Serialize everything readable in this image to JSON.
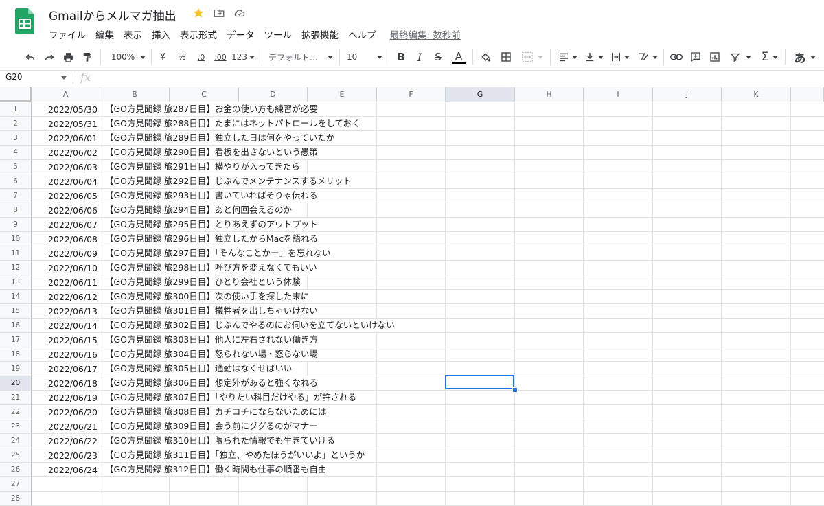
{
  "app": {
    "title": "Gmailからメルマガ抽出",
    "menu": [
      "ファイル",
      "編集",
      "表示",
      "挿入",
      "表示形式",
      "データ",
      "ツール",
      "拡張機能",
      "ヘルプ"
    ],
    "last_edit": "最終編集: 数秒前"
  },
  "toolbar": {
    "zoom": "100%",
    "currency": "¥",
    "percent": "%",
    "decrease_decimal": ".0",
    "increase_decimal": ".00",
    "number_format": "123",
    "font": "デフォルト...",
    "font_size": "10",
    "bold": "B",
    "italic": "I",
    "strike": "S",
    "text_color": "A",
    "input_tool": "あ"
  },
  "formula_bar": {
    "name_box": "G20",
    "fx": "fx",
    "value": ""
  },
  "grid": {
    "columns": [
      "A",
      "B",
      "C",
      "D",
      "E",
      "F",
      "G",
      "H",
      "I",
      "J",
      "K"
    ],
    "selected_column": "G",
    "selected_row": 20,
    "rows": [
      {
        "n": "1",
        "date": "2022/05/30",
        "text": "【GO方見聞録 旅287日目】お金の使い方も練習が必要"
      },
      {
        "n": "2",
        "date": "2022/05/31",
        "text": "【GO方見聞録 旅288日目】たまにはネットパトロールをしておく"
      },
      {
        "n": "3",
        "date": "2022/06/01",
        "text": "【GO方見聞録 旅289日目】独立した日は何をやっていたか"
      },
      {
        "n": "4",
        "date": "2022/06/02",
        "text": "【GO方見聞録 旅290日目】看板を出さないという愚策"
      },
      {
        "n": "5",
        "date": "2022/06/03",
        "text": "【GO方見聞録 旅291日目】横やりが入ってきたら"
      },
      {
        "n": "6",
        "date": "2022/06/04",
        "text": "【GO方見聞録 旅292日目】じぶんでメンテナンスするメリット"
      },
      {
        "n": "7",
        "date": "2022/06/05",
        "text": "【GO方見聞録 旅293日目】書いていればそりゃ伝わる"
      },
      {
        "n": "8",
        "date": "2022/06/06",
        "text": "【GO方見聞録 旅294日目】あと何回会えるのか"
      },
      {
        "n": "9",
        "date": "2022/06/07",
        "text": "【GO方見聞録 旅295日目】とりあえずのアウトプット"
      },
      {
        "n": "10",
        "date": "2022/06/08",
        "text": "【GO方見聞録 旅296日目】独立したからMacを語れる"
      },
      {
        "n": "11",
        "date": "2022/06/09",
        "text": "【GO方見聞録 旅297日目】「そんなことかー」を忘れない"
      },
      {
        "n": "12",
        "date": "2022/06/10",
        "text": "【GO方見聞録 旅298日目】呼び方を変えなくてもいい"
      },
      {
        "n": "13",
        "date": "2022/06/11",
        "text": "【GO方見聞録 旅299日目】ひとり会社という体験"
      },
      {
        "n": "14",
        "date": "2022/06/12",
        "text": "【GO方見聞録 旅300日目】次の使い手を探した末に"
      },
      {
        "n": "15",
        "date": "2022/06/13",
        "text": "【GO方見聞録 旅301日目】犠牲者を出しちゃいけない"
      },
      {
        "n": "16",
        "date": "2022/06/14",
        "text": "【GO方見聞録 旅302日目】じぶんでやるのにお伺いを立てないといけない"
      },
      {
        "n": "17",
        "date": "2022/06/15",
        "text": "【GO方見聞録 旅303日目】他人に左右されない働き方"
      },
      {
        "n": "18",
        "date": "2022/06/16",
        "text": "【GO方見聞録 旅304日目】怒られない場・怒らない場"
      },
      {
        "n": "19",
        "date": "2022/06/17",
        "text": "【GO方見聞録 旅305日目】通勤はなくせばいい"
      },
      {
        "n": "20",
        "date": "2022/06/18",
        "text": "【GO方見聞録 旅306日目】想定外があると強くなれる"
      },
      {
        "n": "21",
        "date": "2022/06/19",
        "text": "【GO方見聞録 旅307日目】「やりたい科目だけやる」が許される"
      },
      {
        "n": "22",
        "date": "2022/06/20",
        "text": "【GO方見聞録 旅308日目】カチコチにならないためには"
      },
      {
        "n": "23",
        "date": "2022/06/21",
        "text": "【GO方見聞録 旅309日目】会う前にググるのがマナー"
      },
      {
        "n": "24",
        "date": "2022/06/22",
        "text": "【GO方見聞録 旅310日目】限られた情報でも生きていける"
      },
      {
        "n": "25",
        "date": "2022/06/23",
        "text": "【GO方見聞録 旅311日目】「独立、やめたほうがいいよ」というか"
      },
      {
        "n": "26",
        "date": "2022/06/24",
        "text": "【GO方見聞録 旅312日目】働く時間も仕事の順番も自由"
      },
      {
        "n": "27",
        "date": "",
        "text": ""
      },
      {
        "n": "28",
        "date": "",
        "text": ""
      }
    ]
  }
}
